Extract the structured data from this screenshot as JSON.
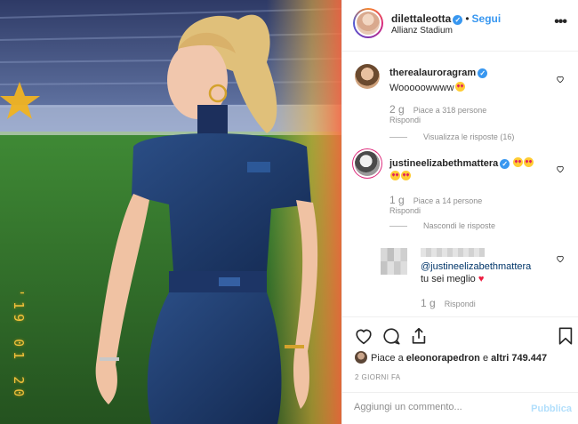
{
  "post": {
    "photo_icon": "photo",
    "date_stamp": "'19 01 20"
  },
  "header": {
    "username": "dilettaleotta",
    "verified": "✓",
    "separator": "•",
    "follow_label": "Segui",
    "location": "Allianz Stadium",
    "more_icon": "ellipsis-icon"
  },
  "comments": [
    {
      "username": "therealauroragram",
      "text": "Wooooowwww",
      "age": "2 g",
      "likes": "Piace a 318 persone",
      "reply": "Rispondi",
      "toggle": "Visualizza le risposte (16)"
    },
    {
      "username": "justineelizabethmattera",
      "text": "",
      "age": "1 g",
      "likes": "Piace a 14 persone",
      "reply": "Rispondi",
      "toggle": "Nascondi le risposte"
    }
  ],
  "reply": {
    "mention": "@justineelizabethmattera",
    "text": "tu sei meglio",
    "age": "1 g",
    "reply": "Rispondi"
  },
  "actions": {
    "liked_prefix": "Piace a",
    "liked_user": "eleonorapedron",
    "liked_joiner": "e",
    "liked_others": "altri 749.447",
    "timestamp": "2 GIORNI FA"
  },
  "composer": {
    "placeholder": "Aggiungi un commento...",
    "publish_label": "Pubblica"
  },
  "colors": {
    "accent": "#3897f0",
    "text": "#262626",
    "muted": "#8e8e8e",
    "heart": "#ed1c40"
  }
}
